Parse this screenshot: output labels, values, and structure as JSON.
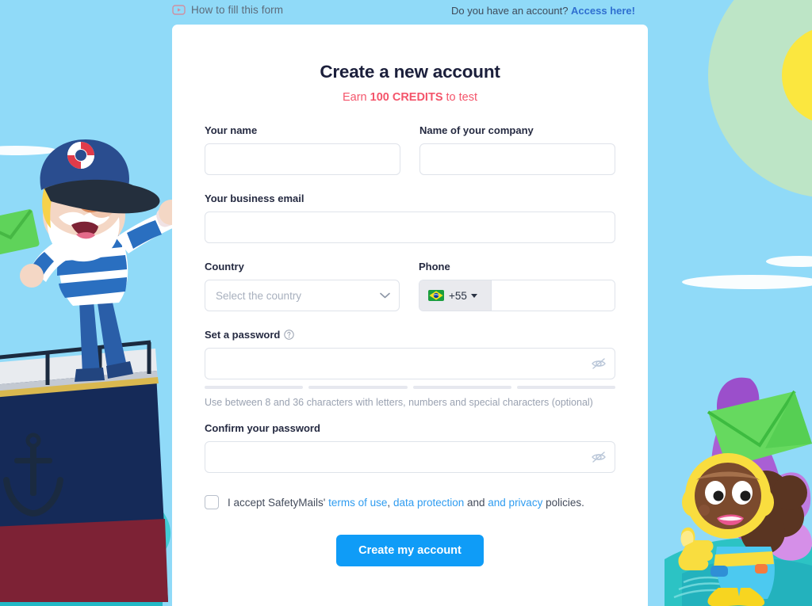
{
  "topbar": {
    "howto_label": "How to fill this form",
    "howto_icon": "play-video-icon",
    "account_question": "Do you have an account?",
    "account_link": "Access here!"
  },
  "card": {
    "title": "Create a new account",
    "subtitle_prefix": "Earn ",
    "subtitle_bold": "100 CREDITS",
    "subtitle_suffix": " to test"
  },
  "form": {
    "name": {
      "label": "Your name",
      "value": "",
      "placeholder": ""
    },
    "company": {
      "label": "Name of your company",
      "value": "",
      "placeholder": ""
    },
    "email": {
      "label": "Your business email",
      "value": "",
      "placeholder": ""
    },
    "country": {
      "label": "Country",
      "value": "",
      "placeholder": "Select the country",
      "selected_text": "Select the country"
    },
    "phone": {
      "label": "Phone",
      "country_code": "+55",
      "flag": "brazil-flag",
      "value": "",
      "placeholder": ""
    },
    "password": {
      "label": "Set a password",
      "help_icon": "question-mark-icon",
      "value": "",
      "placeholder": "",
      "toggle_icon": "eye-off-icon",
      "strength_segments": 4,
      "hint": "Use between 8 and 36 characters with letters, numbers and special characters (optional)"
    },
    "confirm_password": {
      "label": "Confirm your password",
      "value": "",
      "placeholder": "",
      "toggle_icon": "eye-off-icon"
    },
    "terms": {
      "checked": false,
      "prefix": "I accept SafetyMails' ",
      "link1": "terms of use",
      "sep1": ", ",
      "link2": "data protection",
      "sep2": " and ",
      "link3": "and privacy",
      "suffix": " policies."
    },
    "submit_label": "Create my account"
  },
  "colors": {
    "background": "#90daf8",
    "card": "#ffffff",
    "accent_blue": "#0f9cf7",
    "link_blue": "#2f9cf0",
    "title_navy": "#1b1f3b",
    "subtitle_pink": "#f4556b",
    "border_gray": "#dfe3ea",
    "sun_yellow": "#fbe73f",
    "sun_halo": "#bde5c6",
    "sea_teal": "#3fd0c9"
  }
}
